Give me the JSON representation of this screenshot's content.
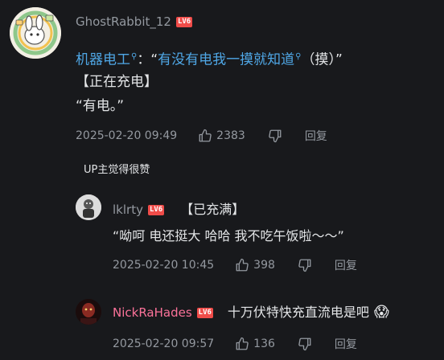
{
  "main_comment": {
    "username": "GhostRabbit_12",
    "level": "LV6",
    "line1": {
      "link1": "机器电工",
      "mid": "：“",
      "link2": "有没有电我一摸就知道",
      "end": "（摸）”"
    },
    "line2": "【正在充电】",
    "line3": "“有电。”",
    "time": "2025-02-20 09:49",
    "likes": "2383",
    "reply_label": "回复",
    "up_tag": "UP主觉得很赞"
  },
  "replies": [
    {
      "username": "lklrty",
      "level": "LV6",
      "line1": "【已充满】",
      "line2": "“呦呵 电还挺大 哈哈 我不吃午饭啦～～”",
      "time": "2025-02-20 10:45",
      "likes": "398",
      "reply_label": "回复"
    },
    {
      "username": "NickRaHades",
      "level": "LV6",
      "text": "十万伏特快充直流电是吧",
      "emoji": "😱",
      "time": "2025-02-20 09:57",
      "likes": "136",
      "reply_label": "回复"
    }
  ],
  "colors": {
    "background": "#18191c",
    "link": "#4fa7e6",
    "level_badge": "#f04c49",
    "vip_name": "#fb7299"
  }
}
